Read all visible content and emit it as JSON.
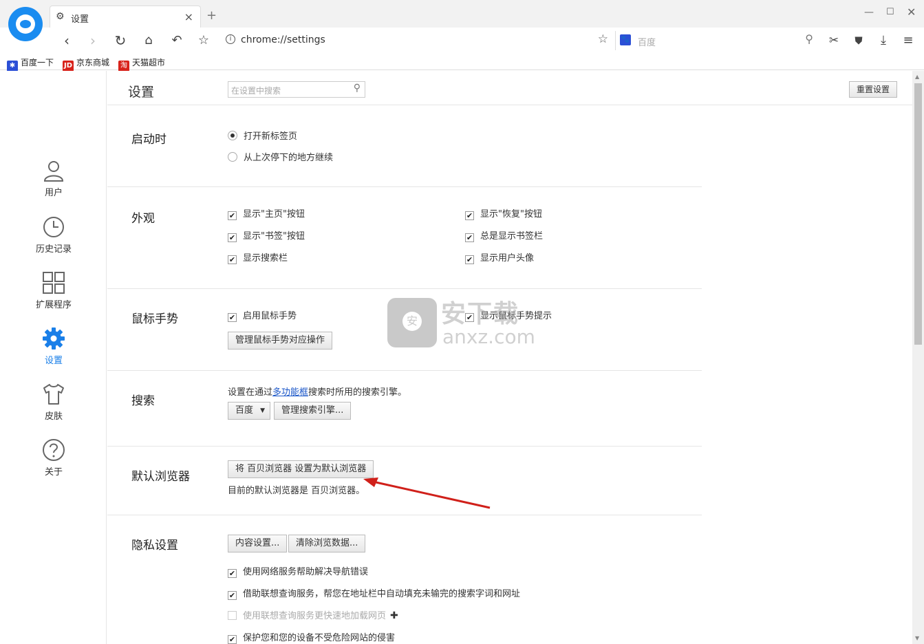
{
  "tab": {
    "title": "设置"
  },
  "toolbar": {
    "url": "chrome://settings",
    "search_placeholder": "百度"
  },
  "bookmarks": [
    {
      "label": "百度一下",
      "icon": "baidu-paw-icon"
    },
    {
      "label": "京东商城",
      "icon": "jd-icon"
    },
    {
      "label": "天猫超市",
      "icon": "tmall-icon"
    }
  ],
  "sidebar": {
    "items": [
      {
        "label": "用户",
        "icon": "user-icon"
      },
      {
        "label": "历史记录",
        "icon": "clock-icon"
      },
      {
        "label": "扩展程序",
        "icon": "grid-icon"
      },
      {
        "label": "设置",
        "icon": "gear-icon",
        "active": true
      },
      {
        "label": "皮肤",
        "icon": "shirt-icon"
      },
      {
        "label": "关于",
        "icon": "question-icon"
      }
    ]
  },
  "header": {
    "title": "设置",
    "search_placeholder": "在设置中搜索",
    "reset_label": "重置设置"
  },
  "startup": {
    "title": "启动时",
    "options": [
      "打开新标签页",
      "从上次停下的地方继续"
    ],
    "selected": 0
  },
  "appearance": {
    "title": "外观",
    "left": [
      "显示\"主页\"按钮",
      "显示\"书签\"按钮",
      "显示搜索栏"
    ],
    "right": [
      "显示\"恢复\"按钮",
      "总是显示书签栏",
      "显示用户头像"
    ]
  },
  "gesture": {
    "title": "鼠标手势",
    "enable": "启用鼠标手势",
    "tips": "显示鼠标手势提示",
    "manage": "管理鼠标手势对应操作"
  },
  "search": {
    "title": "搜索",
    "desc_prefix": "设置在通过",
    "desc_link": "多功能框",
    "desc_suffix": "搜索时所用的搜索引擎。",
    "engine": "百度",
    "manage": "管理搜索引擎..."
  },
  "default_browser": {
    "title": "默认浏览器",
    "button": "将 百贝浏览器 设置为默认浏览器",
    "status": "目前的默认浏览器是 百贝浏览器。"
  },
  "privacy": {
    "title": "隐私设置",
    "content_btn": "内容设置...",
    "clear_btn": "清除浏览数据...",
    "options": [
      {
        "label": "使用网络服务帮助解决导航错误",
        "checked": true,
        "enabled": true
      },
      {
        "label": "借助联想查询服务，帮您在地址栏中自动填充未输完的搜索字词和网址",
        "checked": true,
        "enabled": true
      },
      {
        "label": "使用联想查询服务更快速地加载网页",
        "checked": false,
        "enabled": false
      },
      {
        "label": "保护您和您的设备不受危险网站的侵害",
        "checked": true,
        "enabled": true
      }
    ]
  },
  "watermark": {
    "line1": "安下载",
    "line2": "anxz.com"
  },
  "colors": {
    "accent": "#1a7fe8",
    "annotation_arrow": "#d0201a"
  }
}
